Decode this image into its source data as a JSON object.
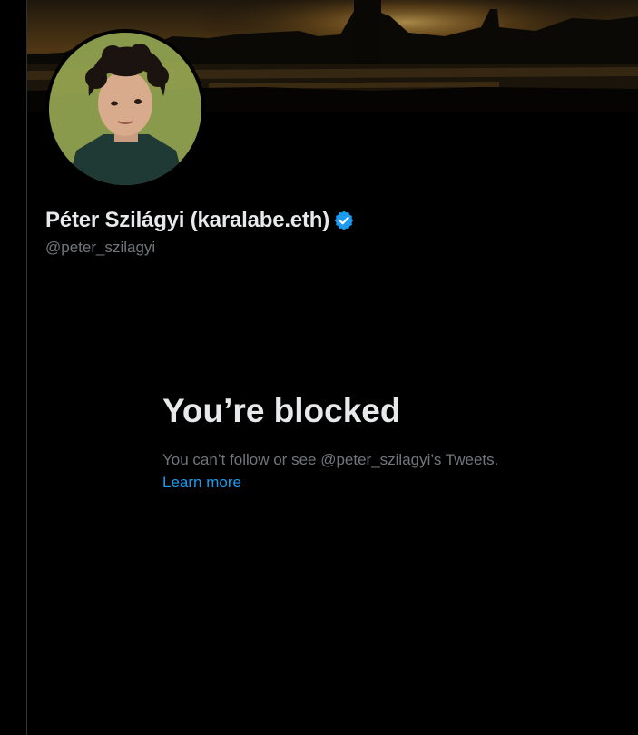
{
  "profile": {
    "display_name": "Péter Szilágyi (karalabe.eth)",
    "handle": "@peter_szilagyi",
    "verified": true,
    "verified_color": "#1d9bf0"
  },
  "blocked": {
    "title": "You’re blocked",
    "message": "You can’t follow or see @peter_szilagyi’s Tweets.",
    "link_label": "Learn more"
  },
  "colors": {
    "background": "#000000",
    "primary_text": "#e7e9ea",
    "secondary_text": "#71767b",
    "accent": "#1d9bf0"
  },
  "icons": {
    "verified": "verified-badge-icon"
  }
}
